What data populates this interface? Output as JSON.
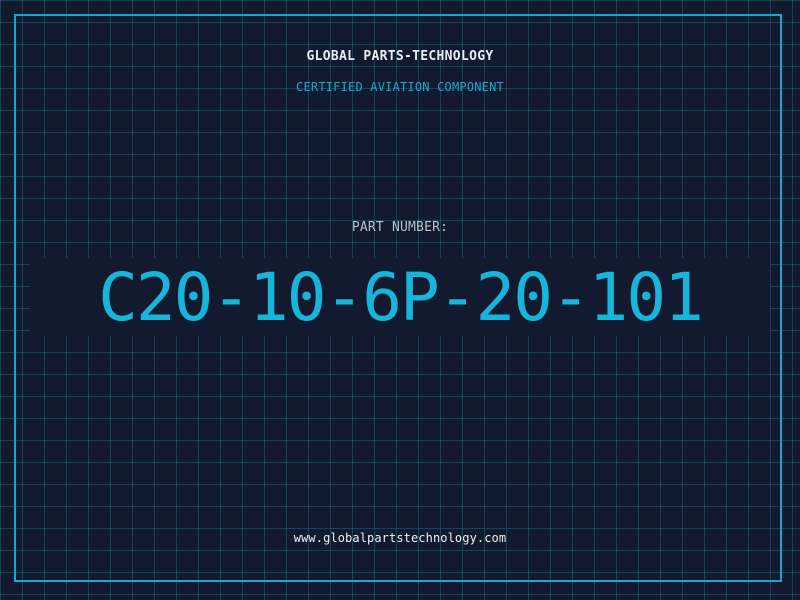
{
  "header": {
    "brand": "GLOBAL PARTS-TECHNOLOGY",
    "subtitle": "CERTIFIED AVIATION COMPONENT"
  },
  "part": {
    "label": "PART NUMBER:",
    "number": "C20-10-6P-20-101"
  },
  "footer": {
    "url": "www.globalpartstechnology.com"
  },
  "colors": {
    "background": "#111a2e",
    "grid": "#1e5f7d",
    "accent": "#14a9cf",
    "text_light": "#e9edf3"
  }
}
